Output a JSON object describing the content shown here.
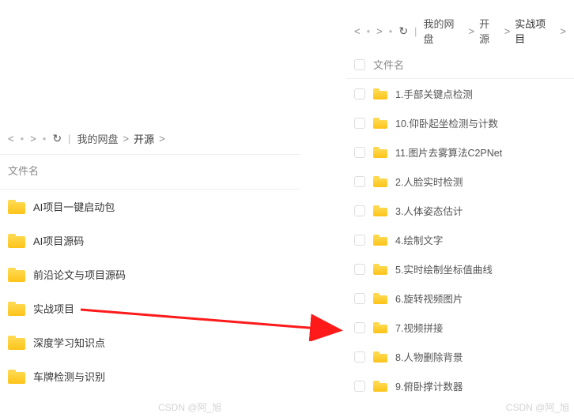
{
  "watermark": "CSDN @阿_旭",
  "left": {
    "breadcrumb": [
      "我的网盘",
      "开源"
    ],
    "header": "文件名",
    "items": [
      {
        "name": "AI项目一键启动包"
      },
      {
        "name": "AI项目源码"
      },
      {
        "name": "前沿论文与项目源码"
      },
      {
        "name": "实战项目"
      },
      {
        "name": "深度学习知识点"
      },
      {
        "name": "车牌检测与识别"
      }
    ]
  },
  "right": {
    "breadcrumb": [
      "我的网盘",
      "开源",
      "实战项目"
    ],
    "header": "文件名",
    "items": [
      {
        "name": "1.手部关键点检测"
      },
      {
        "name": "10.仰卧起坐检测与计数"
      },
      {
        "name": "11.图片去雾算法C2PNet"
      },
      {
        "name": "2.人脸实时检测"
      },
      {
        "name": "3.人体姿态估计"
      },
      {
        "name": "4.绘制文字"
      },
      {
        "name": "5.实时绘制坐标值曲线"
      },
      {
        "name": "6.旋转视频图片"
      },
      {
        "name": "7.视频拼接"
      },
      {
        "name": "8.人物删除背景"
      },
      {
        "name": "9.俯卧撑计数器"
      }
    ]
  }
}
